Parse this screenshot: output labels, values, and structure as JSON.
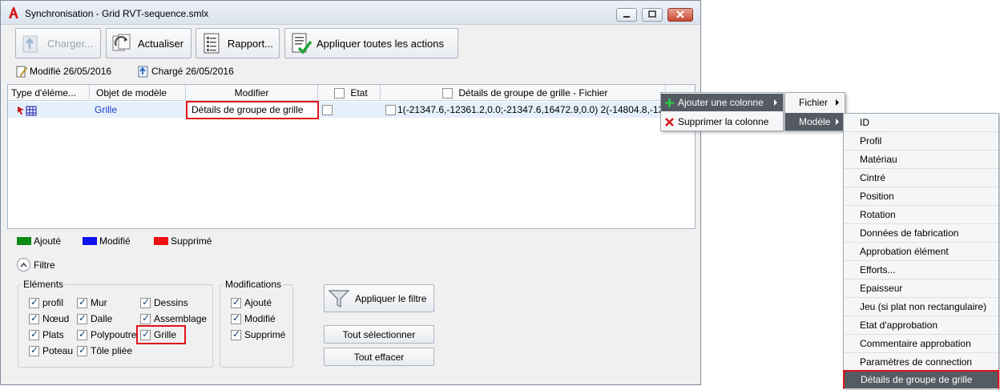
{
  "window": {
    "title": "Synchronisation - Grid RVT-sequence.smlx",
    "app_icon": "autodesk-a-icon"
  },
  "toolbar": {
    "charger_label": "Charger...",
    "actualiser_label": "Actualiser",
    "rapport_label": "Rapport...",
    "appliquer_label": "Appliquer toutes les actions"
  },
  "status": {
    "modifie": "Modifié 26/05/2016",
    "charge": "Chargé 26/05/2016"
  },
  "grid": {
    "headers": {
      "type": "Type d'éléme...",
      "objet": "Objet de modèle",
      "modifier": "Modifier",
      "etat": "Etat",
      "details": "Détails de groupe de grille - Fichier"
    },
    "row": {
      "objet": "Grille",
      "modifier": "Détails de groupe de grille",
      "details": "1(-21347.6,-12361.2,0.0;-21347.6,16472.9,0.0) 2(-14804.8,-12..."
    }
  },
  "legend": {
    "ajoute": "Ajouté",
    "modifie": "Modifié",
    "supprime": "Supprimé",
    "colors": {
      "ajoute": "#0e8a16",
      "modifie": "#1010ee",
      "supprime": "#ee1111"
    }
  },
  "filter": {
    "toggle_label": "Filtre",
    "elements_title": "Eléments",
    "elements": [
      {
        "label": "profil",
        "checked": true
      },
      {
        "label": "Mur",
        "checked": true
      },
      {
        "label": "Dessins",
        "checked": true
      },
      {
        "label": "Nœud",
        "checked": true
      },
      {
        "label": "Dalle",
        "checked": true
      },
      {
        "label": "Assemblage",
        "checked": true
      },
      {
        "label": "Plats",
        "checked": true
      },
      {
        "label": "Polypoutre",
        "checked": true
      },
      {
        "label": "Grille",
        "checked": true
      },
      {
        "label": "Poteau",
        "checked": true
      },
      {
        "label": "Tôle pliée",
        "checked": true
      }
    ],
    "modifications_title": "Modifications",
    "modifications": [
      {
        "label": "Ajouté",
        "checked": true
      },
      {
        "label": "Modifié",
        "checked": true
      },
      {
        "label": "Supprimé",
        "checked": true
      }
    ],
    "apply_label": "Appliquer le filtre",
    "select_all_label": "Tout sélectionner",
    "clear_all_label": "Tout effacer"
  },
  "context_menu": {
    "add_column": "Ajouter une colonne",
    "remove_column": "Supprimer la colonne",
    "submenu": [
      "Fichier",
      "Modèle"
    ],
    "model_items": [
      "ID",
      "Profil",
      "Matériau",
      "Cintré",
      "Position",
      "Rotation",
      "Données de fabrication",
      "Approbation élément",
      "Efforts...",
      "Epaisseur",
      "Jeu (si plat non rectangulaire)",
      "Etat d'approbation",
      "Commentaire approbation",
      "Paramètres de connection",
      "Détails de groupe de grille"
    ],
    "highlighted_item": "Détails de groupe de grille"
  }
}
